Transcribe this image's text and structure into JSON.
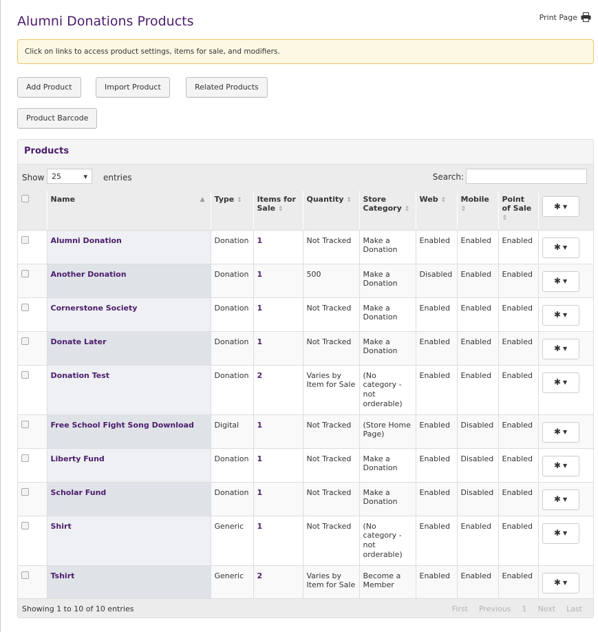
{
  "page": {
    "title": "Alumni Donations Products",
    "print_label": "Print Page",
    "print_icon": "printer-icon",
    "info_message": "Click on links to access product settings, items for sale, and modifiers."
  },
  "actions": {
    "add_product": "Add Product",
    "import_product": "Import Product",
    "related_products": "Related Products",
    "product_barcode": "Product Barcode"
  },
  "panel": {
    "heading": "Products",
    "show_label": "Show",
    "entries_value": "25",
    "entries_label": "entries",
    "search_label": "Search:",
    "search_value": ""
  },
  "columns": {
    "name": "Name",
    "type": "Type",
    "items_for_sale": "Items for Sale",
    "quantity": "Quantity",
    "store_category": "Store Category",
    "web": "Web",
    "mobile": "Mobile",
    "point_of_sale": "Point of Sale"
  },
  "rows": [
    {
      "name": "Alumni Donation",
      "type": "Donation",
      "items": "1",
      "quantity": "Not Tracked",
      "category": "Make a Donation",
      "web": "Enabled",
      "mobile": "Enabled",
      "pos": "Enabled"
    },
    {
      "name": "Another Donation",
      "type": "Donation",
      "items": "1",
      "quantity": "500",
      "category": "Make a Donation",
      "web": "Disabled",
      "mobile": "Enabled",
      "pos": "Enabled"
    },
    {
      "name": "Cornerstone Society",
      "type": "Donation",
      "items": "1",
      "quantity": "Not Tracked",
      "category": "Make a Donation",
      "web": "Enabled",
      "mobile": "Enabled",
      "pos": "Enabled"
    },
    {
      "name": "Donate Later",
      "type": "Donation",
      "items": "1",
      "quantity": "Not Tracked",
      "category": "Make a Donation",
      "web": "Enabled",
      "mobile": "Enabled",
      "pos": "Enabled"
    },
    {
      "name": "Donation Test",
      "type": "Donation",
      "items": "2",
      "quantity": "Varies by Item for Sale",
      "category": "(No category - not orderable)",
      "web": "Enabled",
      "mobile": "Enabled",
      "pos": "Enabled"
    },
    {
      "name": "Free School Fight Song Download",
      "type": "Digital",
      "items": "1",
      "quantity": "Not Tracked",
      "category": "(Store Home Page)",
      "web": "Enabled",
      "mobile": "Disabled",
      "pos": "Enabled"
    },
    {
      "name": "Liberty Fund",
      "type": "Donation",
      "items": "1",
      "quantity": "Not Tracked",
      "category": "Make a Donation",
      "web": "Enabled",
      "mobile": "Disabled",
      "pos": "Enabled"
    },
    {
      "name": "Scholar Fund",
      "type": "Donation",
      "items": "1",
      "quantity": "Not Tracked",
      "category": "Make a Donation",
      "web": "Enabled",
      "mobile": "Disabled",
      "pos": "Enabled"
    },
    {
      "name": "Shirt",
      "type": "Generic",
      "items": "1",
      "quantity": "Not Tracked",
      "category": "(No category - not orderable)",
      "web": "Enabled",
      "mobile": "Enabled",
      "pos": "Enabled"
    },
    {
      "name": "Tshirt",
      "type": "Generic",
      "items": "2",
      "quantity": "Varies by Item for Sale",
      "category": "Become a Member",
      "web": "Enabled",
      "mobile": "Enabled",
      "pos": "Enabled"
    }
  ],
  "footer": {
    "info": "Showing 1 to 10 of 10 entries",
    "first": "First",
    "previous": "Previous",
    "page": "1",
    "next": "Next",
    "last": "Last"
  },
  "colors": {
    "brand_purple": "#4b1c6b",
    "enabled_green": "#6aa84f",
    "disabled_red": "#b23c3c",
    "alert_bg": "#fcf8e3",
    "alert_border": "#f0c36d"
  }
}
